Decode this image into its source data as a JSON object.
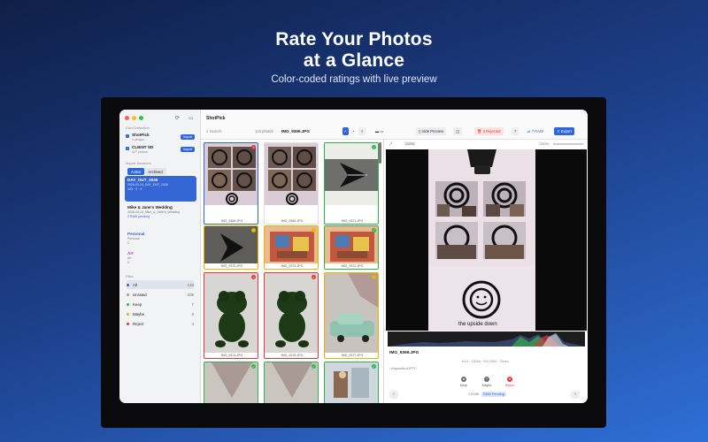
{
  "hero": {
    "title_line1": "Rate Your Photos",
    "title_line2": "at a Glance",
    "subtitle": "Color-coded ratings with live preview"
  },
  "app": {
    "title": "ShotPick"
  },
  "sidebar": {
    "card_section": "Card Detection",
    "cards": [
      {
        "name": "ShotPick",
        "sub": "4 photos",
        "import": "Import"
      },
      {
        "name": "CLIENT SD",
        "sub": "427 photos",
        "import": "Import"
      }
    ],
    "import_section": "Import Sessions",
    "tabs": [
      "Active",
      "Archived"
    ],
    "sessions": [
      {
        "name": "DAY_OUT_2026",
        "date": "2026-03-24_DAY_OUT_2026",
        "meta": "123 · 0 · 4",
        "active": true
      },
      {
        "name": "Mike & Jane's Wedding",
        "date": "2026-03-16_Mike_&_Jane's_Wedding",
        "meta": "2 RAW pending",
        "active": false
      }
    ],
    "projects": [
      {
        "name": "Personal",
        "sub": "Personal",
        "count": "2"
      },
      {
        "name": "Art",
        "sub": "Art",
        "count": "2"
      }
    ],
    "filter_section": "Filter",
    "filters": [
      {
        "label": "All",
        "count": "123",
        "color": "#2f66d9"
      },
      {
        "label": "Unrated",
        "count": "109",
        "color": "#9a9aa0"
      },
      {
        "label": "Keep",
        "count": "7",
        "color": "#2fb34a"
      },
      {
        "label": "Maybe",
        "count": "3",
        "color": "#e8b400"
      },
      {
        "label": "Reject",
        "count": "4",
        "color": "#e0383e"
      }
    ]
  },
  "toolbar": {
    "search_placeholder": "Search",
    "photo_count": "123 photos",
    "current_file": "IMG_9369.JPG",
    "hide_preview": "Hide Preview",
    "rejected": "4 Rejected",
    "raw": "7 RAW",
    "export": "Export"
  },
  "grid": [
    {
      "caption": "IMG_9369.JPG",
      "rating": "reject",
      "art": "booth",
      "selected": true
    },
    {
      "caption": "IMG_9369.JPG",
      "rating": "none",
      "art": "booth",
      "selected": false
    },
    {
      "caption": "IMG_9371.JPG",
      "rating": "keep",
      "art": "symbol",
      "selected": false
    },
    {
      "caption": "IMG_9370.JPG",
      "rating": "maybe",
      "art": "symbol-dark",
      "selected": false
    },
    {
      "caption": "IMG_9373.JPG",
      "rating": "maybe",
      "art": "collage",
      "selected": false
    },
    {
      "caption": "IMG_9372.JPG",
      "rating": "keep",
      "art": "collage",
      "selected": false
    },
    {
      "caption": "IMG_9374.JPG",
      "rating": "reject",
      "art": "frog",
      "selected": false
    },
    {
      "caption": "IMG_9375.JPG",
      "rating": "reject",
      "art": "frog",
      "selected": false
    },
    {
      "caption": "IMG_9377.JPG",
      "rating": "maybe",
      "art": "car",
      "selected": false
    },
    {
      "caption": "",
      "rating": "keep",
      "art": "blur",
      "selected": false
    },
    {
      "caption": "",
      "rating": "keep",
      "art": "blur",
      "selected": false
    },
    {
      "caption": "",
      "rating": "keep",
      "art": "street",
      "selected": false
    }
  ],
  "preview": {
    "zoom_label": "100%",
    "zoom_right": "100%",
    "caption_overlay": "the upside down",
    "filename": "IMG_9369.JPG",
    "meta": "f/4.0 · 1/320s · ISO 2500 · 70mm",
    "keywords": "Keywords & IPTC",
    "ratings": [
      {
        "label": "Keep",
        "color": "#6b6b70"
      },
      {
        "label": "Maybe",
        "color": "#6b6b70"
      },
      {
        "label": "Reject",
        "color": "#e0383e"
      }
    ],
    "file_size": "1.5 MB",
    "raw_status": "RAW Pending"
  },
  "colors": {
    "keep": "#2fb34a",
    "maybe": "#e8b400",
    "reject": "#e0383e",
    "accent": "#2f66d9"
  }
}
